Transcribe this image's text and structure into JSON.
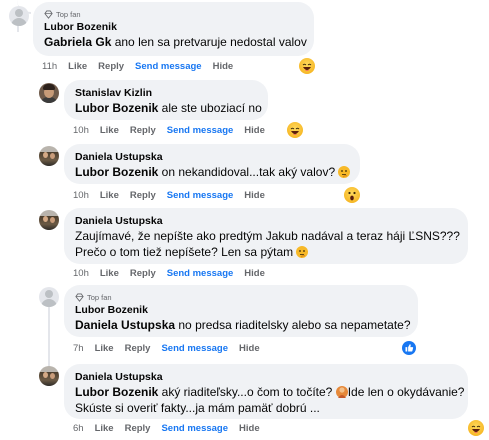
{
  "comments": [
    {
      "top_fan": "Top fan",
      "author": "Lubor Bozenik",
      "mention": "Gabriela Gk",
      "text": " ano len sa pretvaruje nedostal valov",
      "time": "11h",
      "like": "Like",
      "reply": "Reply",
      "send": "Send message",
      "hide": "Hide",
      "reaction": "haha"
    },
    {
      "author": "Stanislav Kizlin",
      "mention": "Lubor Bozenik",
      "text": " ale ste uboziací no",
      "time": "10h",
      "like": "Like",
      "reply": "Reply",
      "send": "Send message",
      "hide": "Hide",
      "reaction": "haha"
    },
    {
      "author": "Daniela Ustupska",
      "mention": "Lubor Bozenik",
      "text": " on nekandidoval...tak aký valov?",
      "time": "10h",
      "like": "Like",
      "reply": "Reply",
      "send": "Send message",
      "hide": "Hide",
      "reaction": "wow"
    },
    {
      "author": "Daniela Ustupska",
      "line1": "Zaujímavé, že nepíšte ako predtým Jakub nadával a teraz háji ĽSNS???",
      "line2": "Prečo o tom tiež nepíšete? Len sa pýtam",
      "time": "10h",
      "like": "Like",
      "reply": "Reply",
      "send": "Send message",
      "hide": "Hide"
    },
    {
      "top_fan": "Top fan",
      "author": "Lubor Bozenik",
      "mention": "Daniela Ustupska",
      "text": " no predsa riaditelsky alebo sa nepametate?",
      "time": "7h",
      "like": "Like",
      "reply": "Reply",
      "send": "Send message",
      "hide": "Hide",
      "reaction": "like"
    },
    {
      "author": "Daniela Ustupska",
      "mention": "Lubor Bozenik",
      "line1_rest": " aký riaditeľsky...o čom to točíte?",
      "line1_end": "Ide len o okydávanie?",
      "line2": "Skúste si overiť fakty...ja mám pamäť dobrú ...",
      "time": "6h",
      "like": "Like",
      "reply": "Reply",
      "send": "Send message",
      "hide": "Hide",
      "reaction": "haha"
    }
  ],
  "colors": {
    "accent": "#1877f2",
    "bubble": "#f0f2f5",
    "meta": "#65676b"
  }
}
